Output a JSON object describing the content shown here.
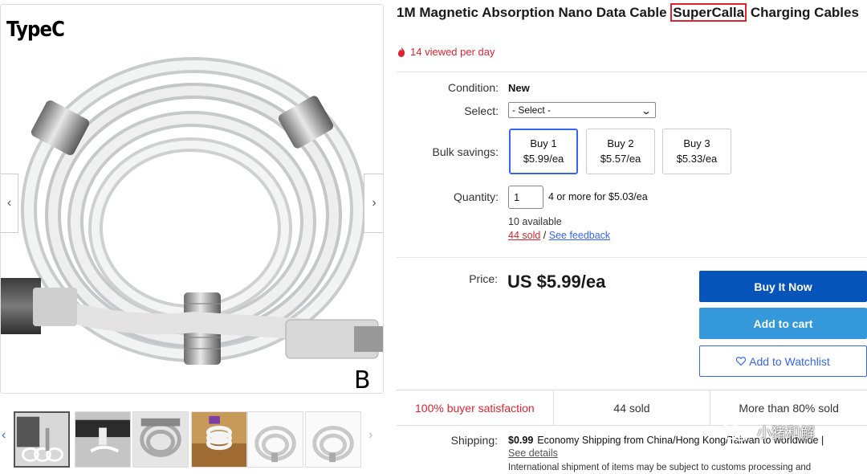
{
  "gallery": {
    "label_top": "TypeC",
    "variant_letter": "B",
    "prev_arrow": "‹",
    "next_arrow": "›",
    "thumb_prev": "‹",
    "thumb_next": "›",
    "thumbnails": [
      "thumb-1",
      "thumb-2",
      "thumb-3",
      "thumb-4",
      "thumb-5",
      "thumb-6"
    ]
  },
  "product": {
    "title_before": "1M Magnetic Absorption Nano Data Cable ",
    "title_highlight": "SuperCalla",
    "title_after": " Charging Cables",
    "views": "14 viewed per day"
  },
  "details": {
    "condition_label": "Condition:",
    "condition_value": "New",
    "select_label": "Select:",
    "select_value": "- Select -",
    "bulk_label": "Bulk savings:",
    "bulk_options": [
      {
        "qty": "Buy 1",
        "price": "$5.99/ea"
      },
      {
        "qty": "Buy 2",
        "price": "$5.57/ea"
      },
      {
        "qty": "Buy 3",
        "price": "$5.33/ea"
      }
    ],
    "quantity_label": "Quantity:",
    "quantity_value": "1",
    "quantity_offer": "4 or more for $5.03/ea",
    "available": "10 available",
    "sold_link": "44 sold",
    "separator": " / ",
    "feedback_link": "See feedback"
  },
  "pricing": {
    "price_label": "Price:",
    "price": "US $5.99/ea",
    "buy_now": "Buy It Now",
    "add_to_cart": "Add to cart",
    "watchlist": "Add to Watchlist"
  },
  "stats": {
    "satisfaction": "100% buyer satisfaction",
    "sold": "44 sold",
    "more_than": "More than 80% sold"
  },
  "shipping": {
    "label": "Shipping:",
    "cost": "$0.99",
    "method": "Economy Shipping from China/Hong Kong/Taiwan to worldwide |",
    "details_link": "See details",
    "international": "International shipment of items may be subject to customs processing and"
  },
  "watermark": {
    "text": "小猪和解"
  },
  "colors": {
    "accent_red": "#e0242f",
    "buy_now_blue": "#0654ba",
    "cart_blue": "#3498db",
    "link_blue": "#3665f3"
  }
}
